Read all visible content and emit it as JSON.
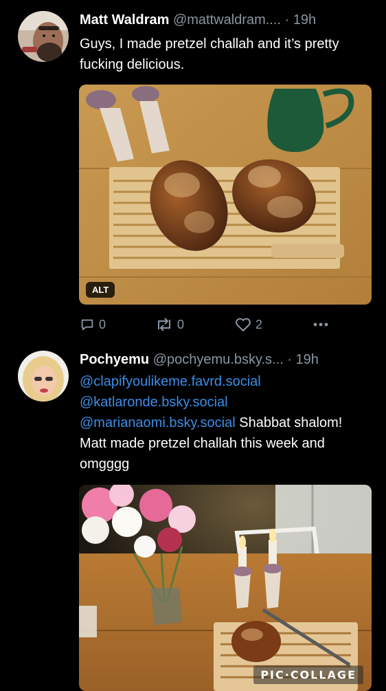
{
  "posts": [
    {
      "author": {
        "name": "Matt Waldram",
        "handle": "@mattwaldram....",
        "separator": "·",
        "time": "19h"
      },
      "text": "Guys, I made pretzel challah and it’s pretty fucking delicious.",
      "image": {
        "alt_label": "ALT"
      },
      "actions": {
        "replies": "0",
        "reposts": "0",
        "likes": "2",
        "more_icon": "more-horizontal-icon"
      }
    },
    {
      "author": {
        "name": "Pochyemu",
        "handle": "@pochyemu.bsky.s...",
        "separator": "·",
        "time": "19h"
      },
      "mentions": [
        "@clapifyoulikeme.favrd.social",
        "@katlaronde.bsky.social",
        "@marianaomi.bsky.social"
      ],
      "text_after_mentions": " Shabbat shalom! Matt made pretzel challah this week and omgggg",
      "image": {
        "watermark": "PIC·COLLAGE"
      }
    }
  ],
  "colors": {
    "background": "#000000",
    "mention": "#3b8ee8",
    "secondary_text": "#8a96a3"
  }
}
